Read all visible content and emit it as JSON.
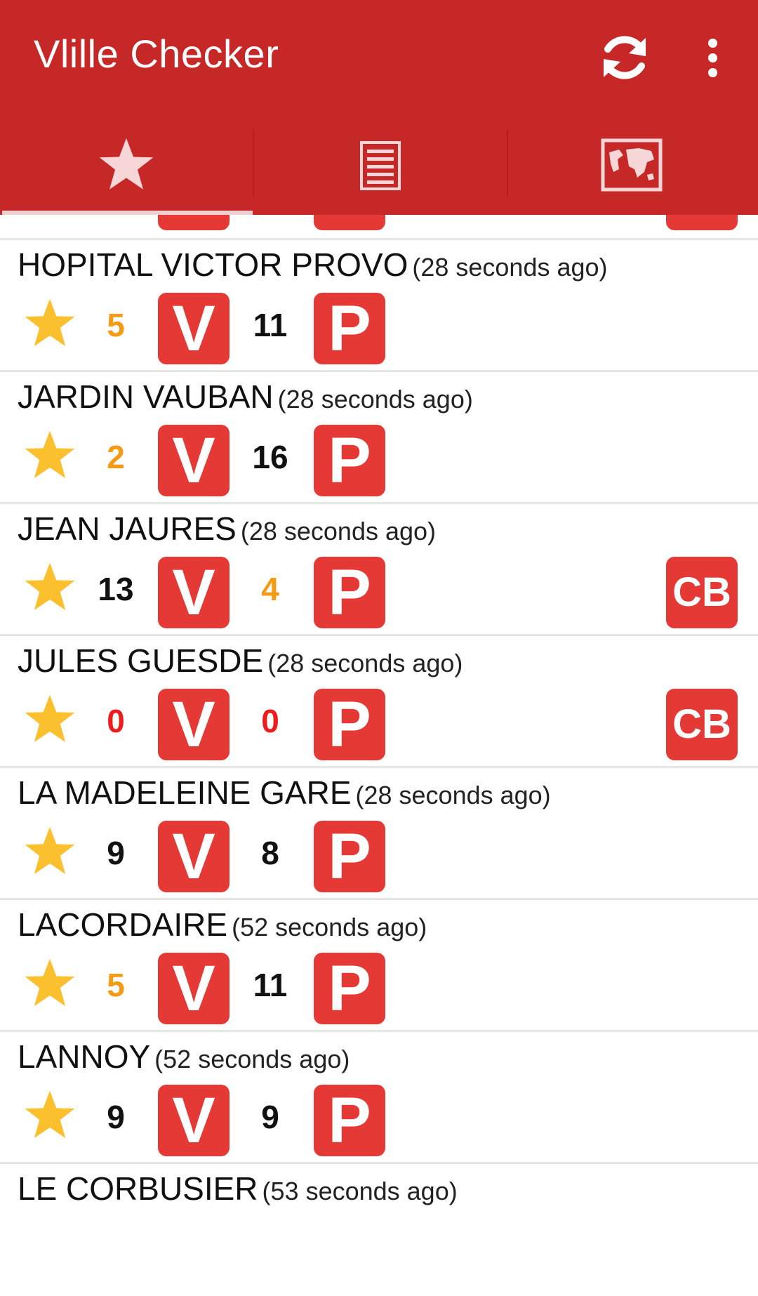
{
  "app": {
    "title": "Vlille Checker",
    "colors": {
      "primary": "#c62828",
      "badge": "#e53935",
      "star": "#fbc02d",
      "low": "#f59a14",
      "empty": "#ee1c1c"
    },
    "actions": {
      "refresh_icon": "refresh-icon",
      "more_icon": "more-vert-icon"
    }
  },
  "tabs": [
    {
      "icon": "star-icon",
      "selected": true
    },
    {
      "icon": "list-icon",
      "selected": false
    },
    {
      "icon": "map-icon",
      "selected": false
    }
  ],
  "badges": {
    "bikes": "V",
    "parking": "P",
    "card": "CB"
  },
  "stations": [
    {
      "name": "HOPITAL VICTOR PROVO",
      "ago": "(28 seconds ago)",
      "bikes": "5",
      "bikes_level": "low",
      "parks": "11",
      "parks_level": "normal",
      "cb": false
    },
    {
      "name": "JARDIN VAUBAN",
      "ago": "(28 seconds ago)",
      "bikes": "2",
      "bikes_level": "low",
      "parks": "16",
      "parks_level": "normal",
      "cb": false
    },
    {
      "name": "JEAN JAURES",
      "ago": "(28 seconds ago)",
      "bikes": "13",
      "bikes_level": "normal",
      "parks": "4",
      "parks_level": "low",
      "cb": true
    },
    {
      "name": "JULES GUESDE",
      "ago": "(28 seconds ago)",
      "bikes": "0",
      "bikes_level": "empty",
      "parks": "0",
      "parks_level": "empty",
      "cb": true
    },
    {
      "name": "LA MADELEINE GARE",
      "ago": "(28 seconds ago)",
      "bikes": "9",
      "bikes_level": "normal",
      "parks": "8",
      "parks_level": "normal",
      "cb": false
    },
    {
      "name": "LACORDAIRE",
      "ago": "(52 seconds ago)",
      "bikes": "5",
      "bikes_level": "low",
      "parks": "11",
      "parks_level": "normal",
      "cb": false
    },
    {
      "name": "LANNOY",
      "ago": "(52 seconds ago)",
      "bikes": "9",
      "bikes_level": "normal",
      "parks": "9",
      "parks_level": "normal",
      "cb": false
    },
    {
      "name": "LE CORBUSIER",
      "ago": "(53 seconds ago)",
      "partial": true
    }
  ]
}
